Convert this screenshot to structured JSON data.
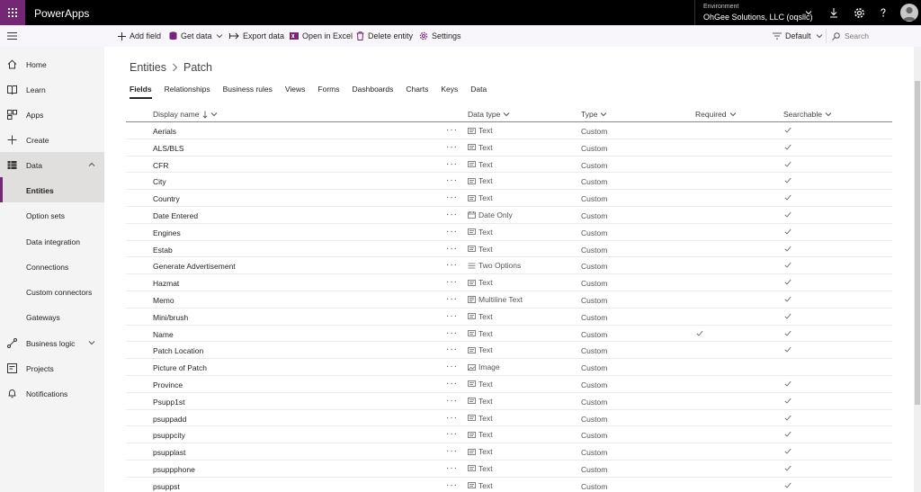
{
  "app": {
    "title": "PowerApps"
  },
  "environment": {
    "label": "Environment",
    "name": "OhGee Solutions, LLC (oqsllc)"
  },
  "topbar_icons": [
    "download-icon",
    "gear-icon",
    "help-icon",
    "avatar-icon"
  ],
  "commands": {
    "add_field": "Add field",
    "get_data": "Get data",
    "export_data": "Export data",
    "open_excel": "Open in Excel",
    "delete_entity": "Delete entity",
    "settings": "Settings",
    "view": "Default",
    "search_placeholder": "Search"
  },
  "nav": {
    "home": "Home",
    "learn": "Learn",
    "apps": "Apps",
    "create": "Create",
    "data": "Data",
    "entities": "Entities",
    "option_sets": "Option sets",
    "data_integration": "Data integration",
    "connections": "Connections",
    "custom_connectors": "Custom connectors",
    "gateways": "Gateways",
    "business_logic": "Business logic",
    "projects": "Projects",
    "notifications": "Notifications"
  },
  "breadcrumb": {
    "root": "Entities",
    "current": "Patch"
  },
  "tabs": [
    "Fields",
    "Relationships",
    "Business rules",
    "Views",
    "Forms",
    "Dashboards",
    "Charts",
    "Keys",
    "Data"
  ],
  "columns": {
    "display_name": "Display name",
    "data_type": "Data type",
    "type": "Type",
    "required": "Required",
    "searchable": "Searchable"
  },
  "more_label": "···",
  "rows": [
    {
      "name": "Aerials",
      "dtype": "Text",
      "icon": "text",
      "type": "Custom",
      "required": false,
      "searchable": true
    },
    {
      "name": "ALS/BLS",
      "dtype": "Text",
      "icon": "text",
      "type": "Custom",
      "required": false,
      "searchable": true
    },
    {
      "name": "CFR",
      "dtype": "Text",
      "icon": "text",
      "type": "Custom",
      "required": false,
      "searchable": true
    },
    {
      "name": "City",
      "dtype": "Text",
      "icon": "text",
      "type": "Custom",
      "required": false,
      "searchable": true
    },
    {
      "name": "Country",
      "dtype": "Text",
      "icon": "text",
      "type": "Custom",
      "required": false,
      "searchable": true
    },
    {
      "name": "Date Entered",
      "dtype": "Date Only",
      "icon": "date",
      "type": "Custom",
      "required": false,
      "searchable": true
    },
    {
      "name": "Engines",
      "dtype": "Text",
      "icon": "text",
      "type": "Custom",
      "required": false,
      "searchable": true
    },
    {
      "name": "Estab",
      "dtype": "Text",
      "icon": "text",
      "type": "Custom",
      "required": false,
      "searchable": true
    },
    {
      "name": "Generate Advertisement",
      "dtype": "Two Options",
      "icon": "list",
      "type": "Custom",
      "required": false,
      "searchable": true
    },
    {
      "name": "Hazmat",
      "dtype": "Text",
      "icon": "text",
      "type": "Custom",
      "required": false,
      "searchable": true
    },
    {
      "name": "Memo",
      "dtype": "Multiline Text",
      "icon": "multiline",
      "type": "Custom",
      "required": false,
      "searchable": true
    },
    {
      "name": "Mini/brush",
      "dtype": "Text",
      "icon": "text",
      "type": "Custom",
      "required": false,
      "searchable": true
    },
    {
      "name": "Name",
      "dtype": "Text",
      "icon": "text",
      "type": "Custom",
      "required": true,
      "searchable": true
    },
    {
      "name": "Patch Location",
      "dtype": "Text",
      "icon": "text",
      "type": "Custom",
      "required": false,
      "searchable": true
    },
    {
      "name": "Picture of Patch",
      "dtype": "Image",
      "icon": "image",
      "type": "Custom",
      "required": false,
      "searchable": false
    },
    {
      "name": "Province",
      "dtype": "Text",
      "icon": "text",
      "type": "Custom",
      "required": false,
      "searchable": true
    },
    {
      "name": "Psupp1st",
      "dtype": "Text",
      "icon": "text",
      "type": "Custom",
      "required": false,
      "searchable": true
    },
    {
      "name": "psuppadd",
      "dtype": "Text",
      "icon": "text",
      "type": "Custom",
      "required": false,
      "searchable": true
    },
    {
      "name": "psuppcity",
      "dtype": "Text",
      "icon": "text",
      "type": "Custom",
      "required": false,
      "searchable": true
    },
    {
      "name": "psupplast",
      "dtype": "Text",
      "icon": "text",
      "type": "Custom",
      "required": false,
      "searchable": true
    },
    {
      "name": "psuppphone",
      "dtype": "Text",
      "icon": "text",
      "type": "Custom",
      "required": false,
      "searchable": true
    },
    {
      "name": "psuppst",
      "dtype": "Text",
      "icon": "text",
      "type": "Custom",
      "required": false,
      "searchable": true
    }
  ],
  "colors": {
    "brand": "#742774",
    "topbar": "#000000",
    "nav_bg": "#f4f4f4"
  }
}
